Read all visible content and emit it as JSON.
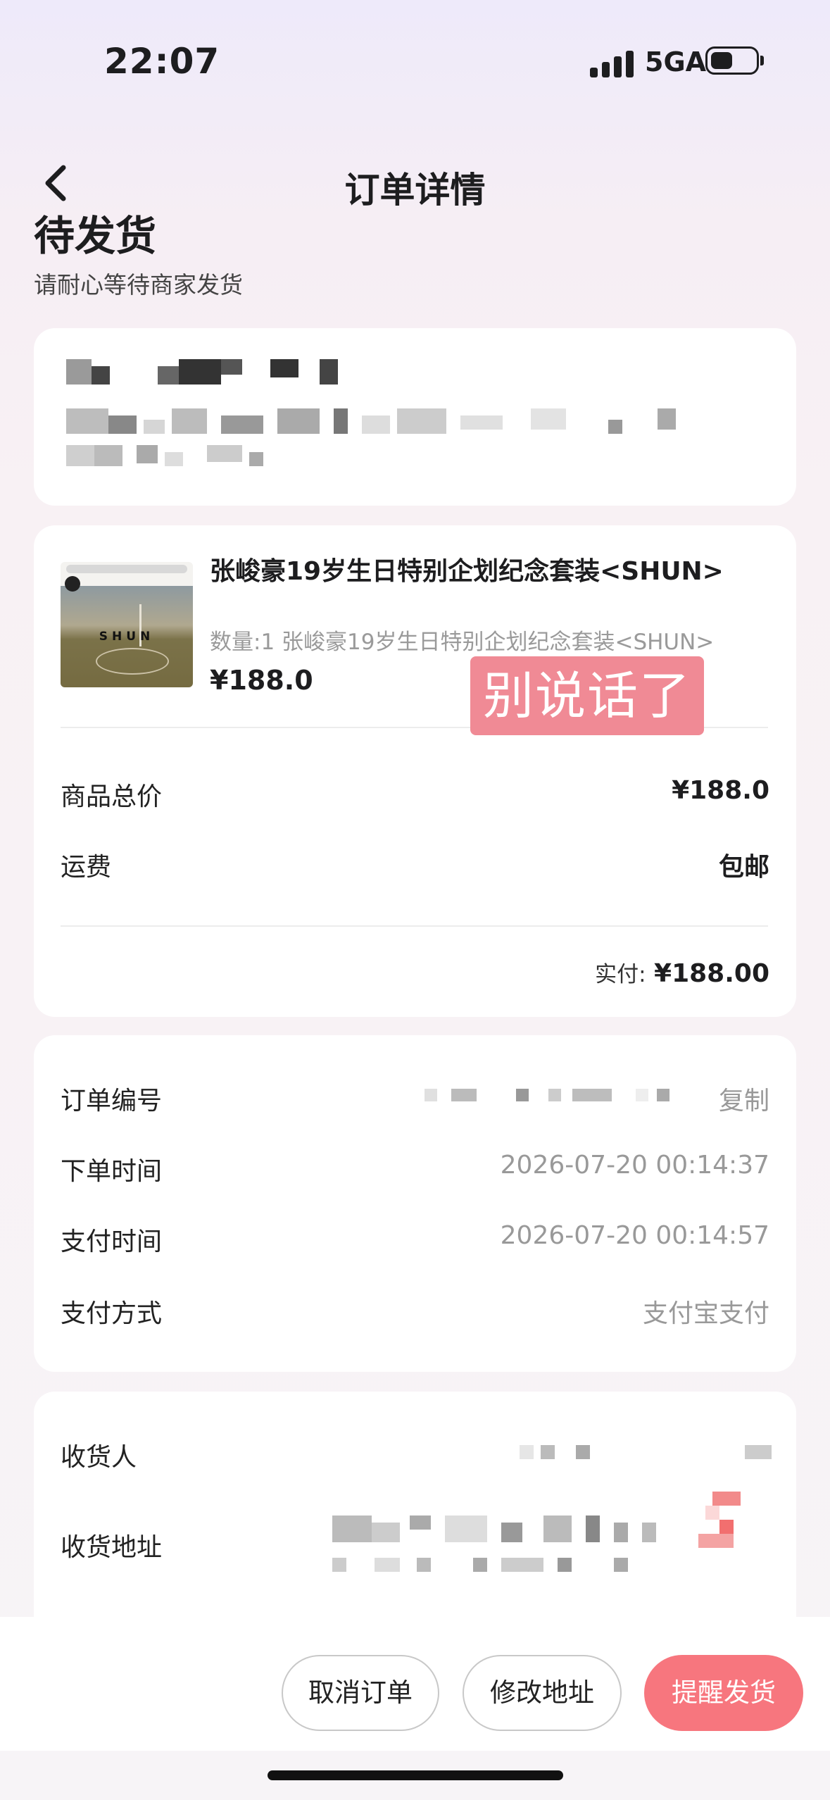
{
  "status_bar": {
    "time": "22:07",
    "network": "5GA"
  },
  "nav": {
    "title": "订单详情"
  },
  "order_status": {
    "title": "待发货",
    "subtitle": "请耐心等待商家发货"
  },
  "product": {
    "title": "张峻豪19岁生日特别企划纪念套装<SHUN>",
    "spec": "数量:1 张峻豪19岁生日特别企划纪念套装<SHUN>",
    "price": "¥188.0",
    "image_word": "SHUN"
  },
  "sticker_text": "别说话了",
  "price_summary": {
    "subtotal_label": "商品总价",
    "subtotal_value": "¥188.0",
    "shipping_label": "运费",
    "shipping_value": "包邮",
    "paid_label": "实付:",
    "paid_value": "¥188.00"
  },
  "order_info": {
    "order_no_label": "订单编号",
    "copy_label": "复制",
    "order_time_label": "下单时间",
    "order_time_value": "2026-07-20 00:14:37",
    "pay_time_label": "支付时间",
    "pay_time_value": "2026-07-20 00:14:57",
    "pay_method_label": "支付方式",
    "pay_method_value": "支付宝支付"
  },
  "recipient": {
    "name_label": "收货人",
    "address_label": "收货地址"
  },
  "actions": {
    "cancel": "取消订单",
    "modify_address": "修改地址",
    "remind": "提醒发货"
  },
  "colors": {
    "accent": "#f7767e",
    "sticker": "#f08a95"
  }
}
